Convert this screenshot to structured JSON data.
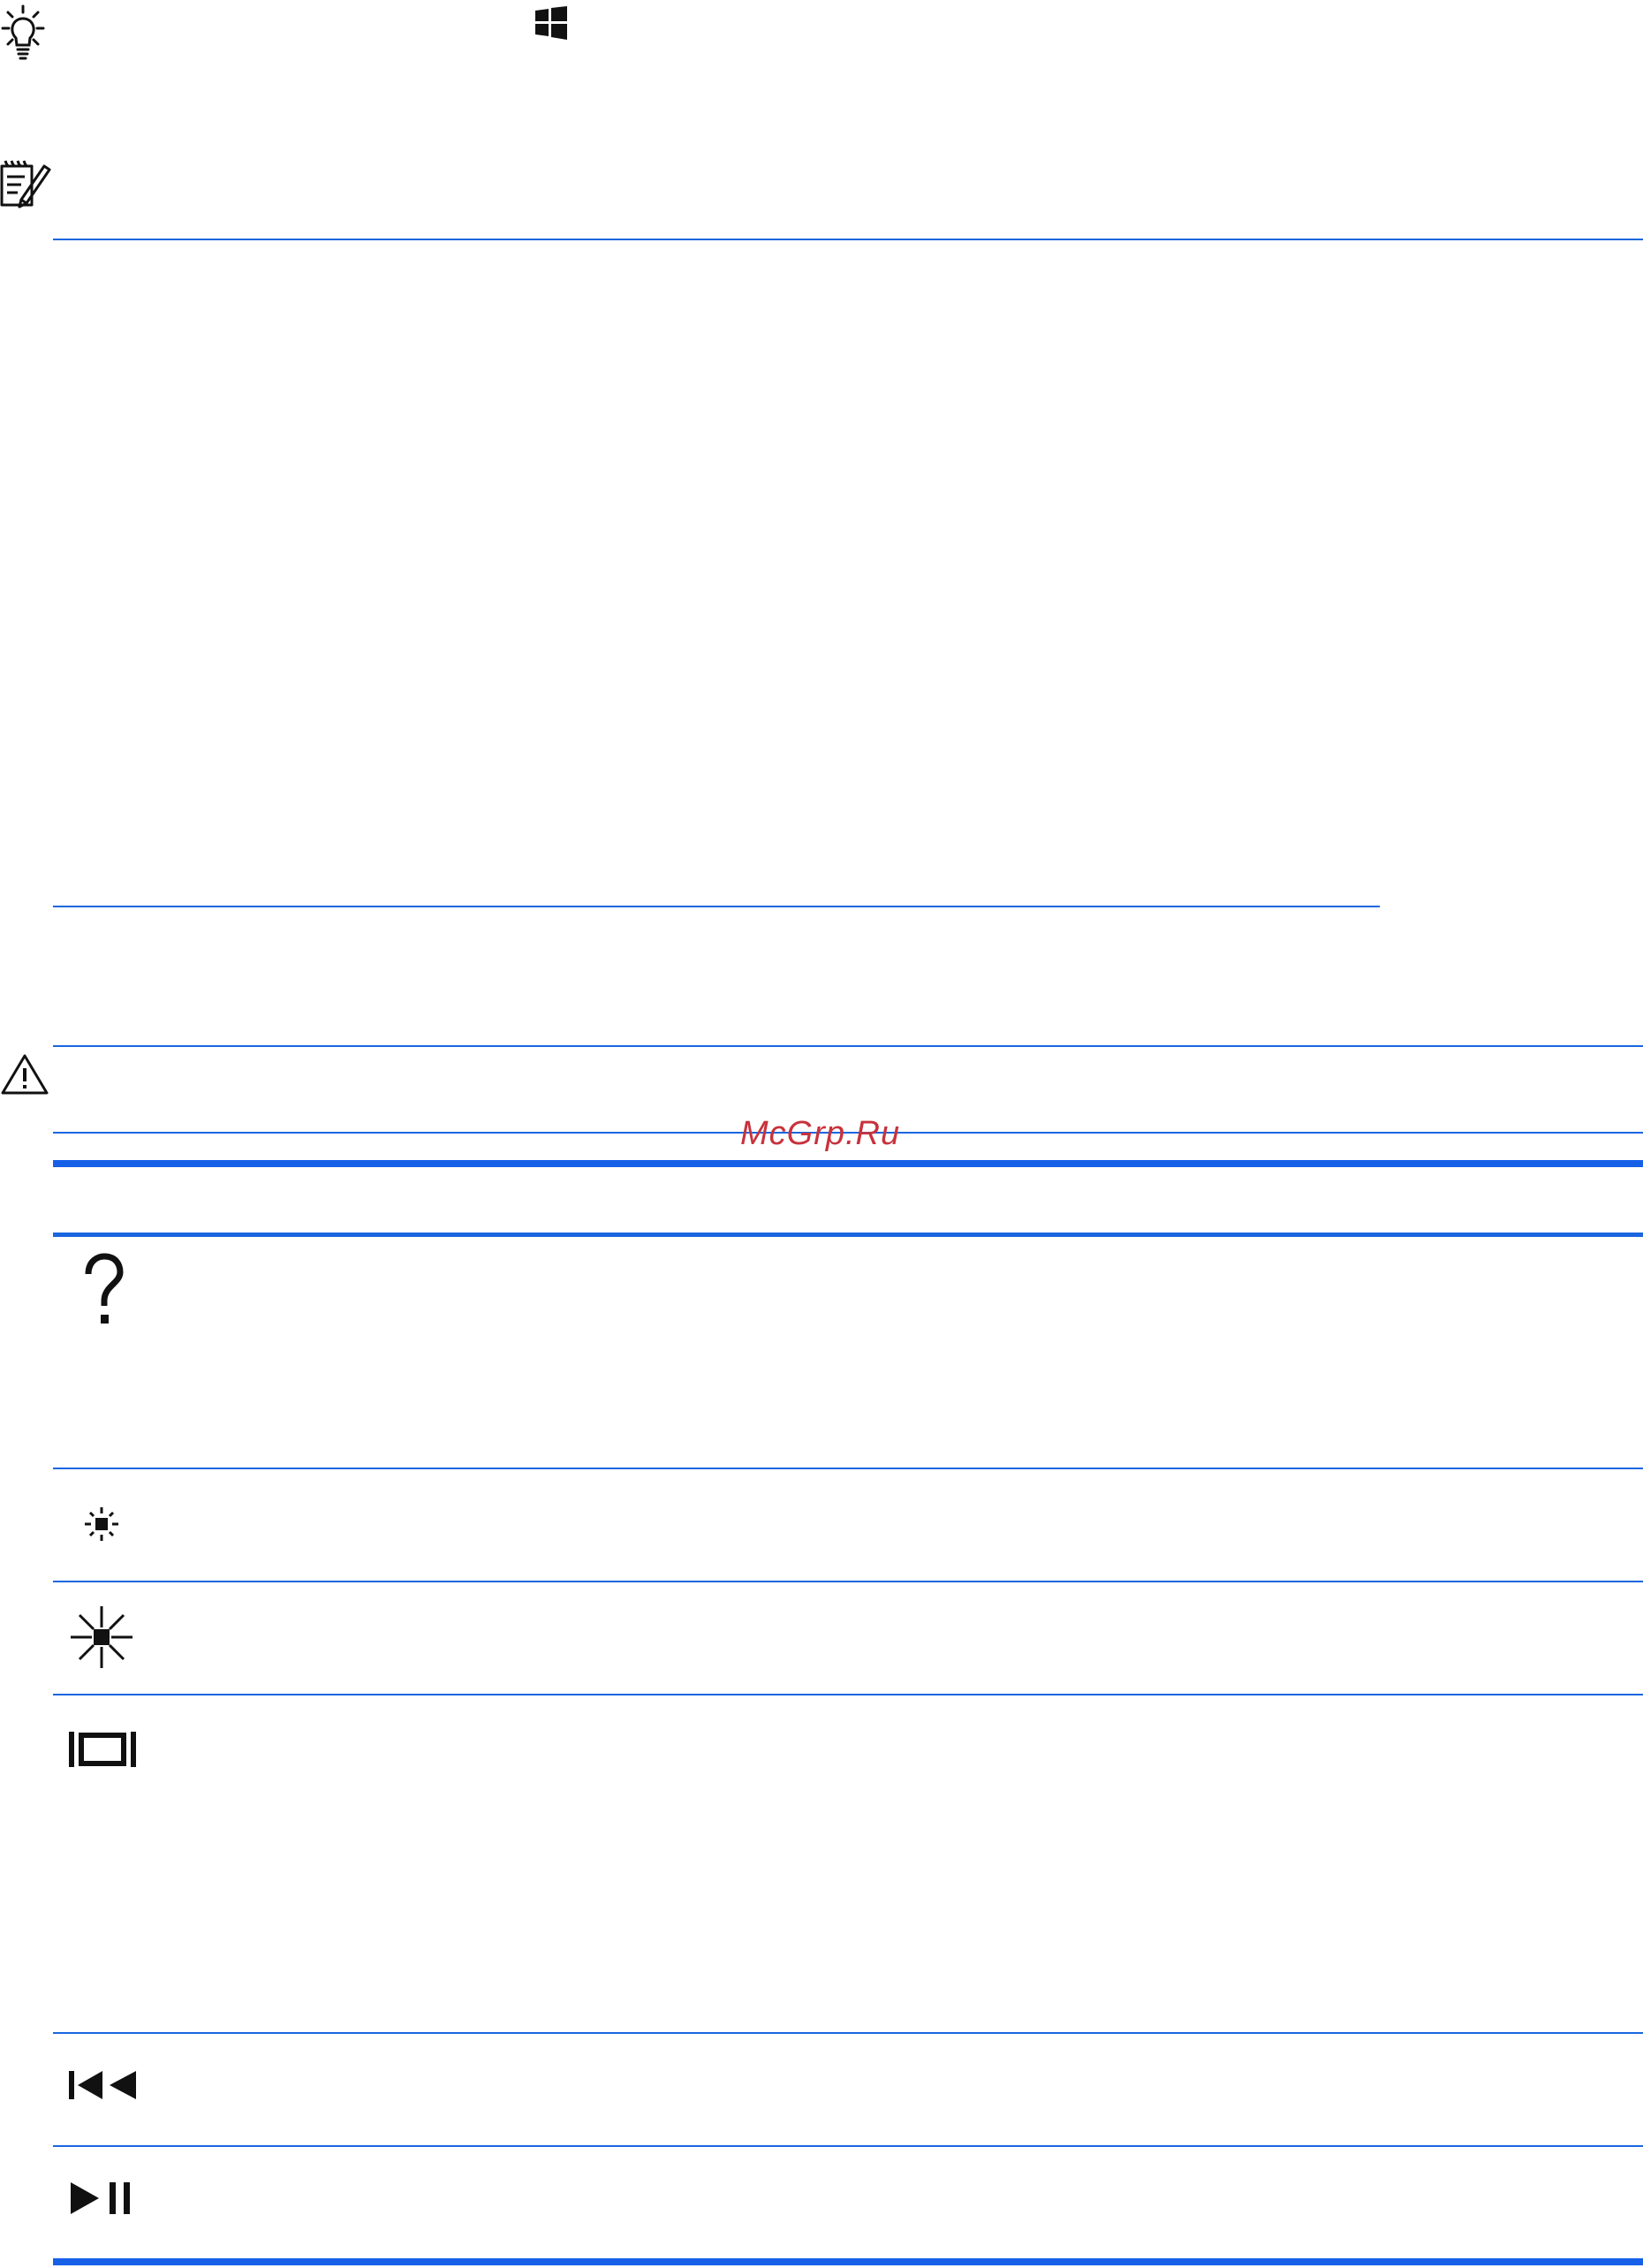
{
  "watermark": "McGrp.Ru",
  "icons": {
    "tip": "lightbulb-icon",
    "windows": "windows-logo-icon",
    "note": "note-pencil-icon",
    "caution": "warning-triangle-icon",
    "help": "question-mark-icon",
    "brightness_down": "brightness-down-icon",
    "brightness_up": "brightness-up-icon",
    "display_switch": "switch-display-icon",
    "previous_track": "previous-track-icon",
    "play_pause": "play-pause-icon"
  },
  "colors": {
    "rule": "#1a66e0",
    "watermark": "#c8323c",
    "icon": "#000000"
  }
}
